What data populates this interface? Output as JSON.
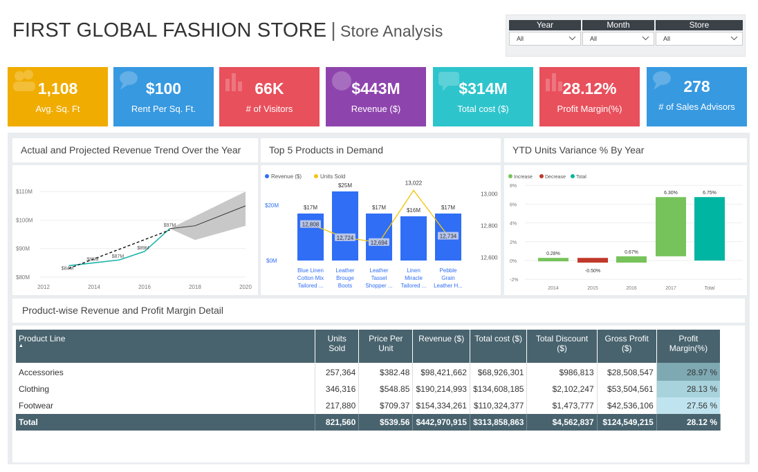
{
  "header": {
    "title": "FIRST GLOBAL FASHION STORE",
    "separator": "|",
    "subtitle": "Store Analysis"
  },
  "slicers": [
    {
      "label": "Year",
      "value": "All"
    },
    {
      "label": "Month",
      "value": "All"
    },
    {
      "label": "Store",
      "value": "All"
    }
  ],
  "kpis": [
    {
      "value": "1,108",
      "label": "Avg. Sq. Ft",
      "color": "#f0ac00",
      "icon": "people-icon"
    },
    {
      "value": "$100",
      "label": "Rent Per Sq. Ft.",
      "color": "#3799e0",
      "icon": "speech-bubbles-icon"
    },
    {
      "value": "66K",
      "label": "# of Visitors",
      "color": "#e8505c",
      "icon": "bar-chart-icon"
    },
    {
      "value": "$443M",
      "label": "Revenue ($)",
      "color": "#8e44ad",
      "icon": "globe-icon"
    },
    {
      "value": "$314M",
      "label": "Total cost ($)",
      "color": "#2ec4cc",
      "icon": "chat-icon"
    },
    {
      "value": "28.12%",
      "label": "Profit Margin(%)",
      "color": "#e8505c",
      "icon": "bar-chart-icon"
    },
    {
      "value": "278",
      "label": "# of Sales Advisors",
      "color": "#3799e0",
      "icon": "speech-bubbles-icon"
    }
  ],
  "panels": {
    "trend_title": "Actual and Projected Revenue Trend Over the Year",
    "top5_title": "Top 5 Products in Demand",
    "ytd_title": "YTD Units Variance % By Year",
    "table_title": "Product-wise Revenue and Profit Margin Detail"
  },
  "colors": {
    "teal": "#1ab3a9",
    "blue": "#2f6ef5",
    "gold": "#f2c511",
    "increase": "#77c35b",
    "decrease": "#c0392b",
    "total": "#00b5a1",
    "table_header": "#48636e"
  },
  "chart_data": [
    {
      "type": "line",
      "title": "Actual and Projected Revenue Trend Over the Year",
      "x_ticks": [
        "2012",
        "2014",
        "2016",
        "2018",
        "2020"
      ],
      "y_ticks": [
        "$80M",
        "$90M",
        "$100M",
        "$110M"
      ],
      "ylim": [
        79,
        112
      ],
      "series": [
        {
          "values": [
            [
              2013,
              84
            ],
            [
              2014,
              85
            ],
            [
              2015,
              86
            ],
            [
              2016,
              89
            ],
            [
              2017,
              97
            ]
          ],
          "style": "actual"
        },
        {
          "values": [
            [
              2017,
              97
            ],
            [
              2018,
              98
            ],
            [
              2020,
              105
            ]
          ],
          "style": "forecast"
        },
        {
          "values": [
            [
              2013,
              83
            ],
            [
              2017,
              96.5
            ]
          ],
          "style": "trend"
        }
      ],
      "band": {
        "upper": [
          [
            2017,
            97
          ],
          [
            2020,
            110
          ]
        ],
        "lower": [
          [
            2017,
            97
          ],
          [
            2018,
            93
          ],
          [
            2020,
            98
          ]
        ]
      },
      "data_labels": [
        "$84M",
        "$85M",
        "$87M",
        "$89M",
        "$97M"
      ]
    },
    {
      "type": "bar",
      "title": "Top 5 Products in Demand",
      "categories": [
        "Blue Linen Cotton Mix Tailored ...",
        "Leather Brouge Boots",
        "Leather Tassel Shopper ...",
        "Linen Miracle Tailored ...",
        "Pebble Grain Leather H..."
      ],
      "series": [
        {
          "name": "Revenue ($)",
          "values": [
            17,
            25,
            17,
            16,
            17
          ],
          "labels": [
            "$17M",
            "$25M",
            "$17M",
            "$16M",
            "$17M"
          ]
        },
        {
          "name": "Units Sold",
          "values": [
            12808,
            12724,
            12694,
            13022,
            12734
          ],
          "labels": [
            "12,808",
            "12,724",
            "12,694",
            "13,022",
            "12,734"
          ]
        }
      ],
      "y_ticks": [
        "$0M",
        "$20M"
      ],
      "y2_ticks": [
        "12,600",
        "12,800",
        "13,000"
      ]
    },
    {
      "type": "bar",
      "title": "YTD Units Variance % By Year",
      "legend": [
        "Increase",
        "Decrease",
        "Total"
      ],
      "categories": [
        "2014",
        "2015",
        "2016",
        "2017",
        "Total"
      ],
      "values": [
        0.28,
        -0.5,
        0.67,
        6.3,
        6.75
      ],
      "labels": [
        "0.28%",
        "-0.50%",
        "0.67%",
        "6.30%",
        "6.75%"
      ],
      "kinds": [
        "increase",
        "decrease",
        "increase",
        "increase",
        "total"
      ],
      "y_ticks": [
        "8%",
        "6%",
        "4%",
        "2%",
        "0%",
        "-2%"
      ]
    }
  ],
  "table": {
    "columns": [
      "Product Line",
      "Units Sold",
      "Price Per Unit",
      "Revenue ($)",
      "Total cost ($)",
      "Total Discount ($)",
      "Gross Profit ($)",
      "Profit Margin(%)"
    ],
    "rows": [
      [
        "Accessories",
        "257,364",
        "$382.48",
        "$98,421,662",
        "$68,926,301",
        "$986,813",
        "$28,508,547",
        "28.97 %"
      ],
      [
        "Clothing",
        "346,316",
        "$548.85",
        "$190,214,993",
        "$134,608,185",
        "$2,102,247",
        "$53,504,561",
        "28.13 %"
      ],
      [
        "Footwear",
        "217,880",
        "$709.37",
        "$154,334,261",
        "$110,324,377",
        "$1,473,777",
        "$42,536,106",
        "27.56 %"
      ]
    ],
    "total": [
      "Total",
      "821,560",
      "$539.56",
      "$442,970,915",
      "$313,858,863",
      "$4,562,837",
      "$124,549,215",
      "28.12 %"
    ]
  }
}
